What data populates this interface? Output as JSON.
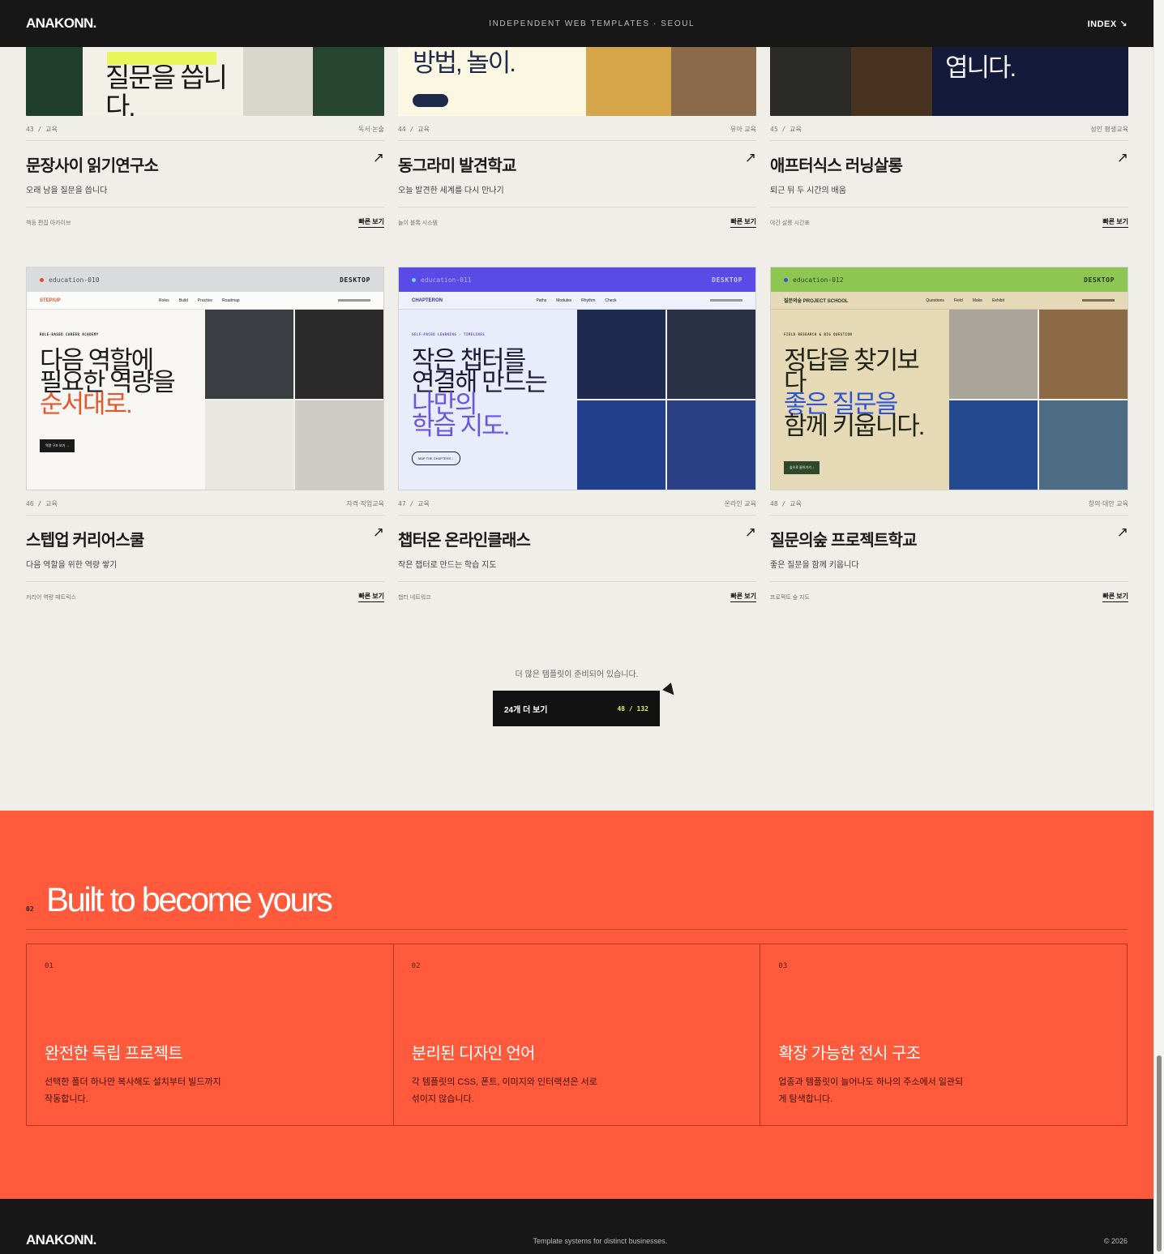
{
  "header": {
    "logo": "ANAKONN.",
    "tagline": "INDEPENDENT WEB TEMPLATES · SEOUL",
    "index": "INDEX ↘"
  },
  "row1": [
    {
      "num": "43 / 교육",
      "category": "독서·논술",
      "title": "문장사이 읽기연구소",
      "subtitle": "오래 남을 질문을 씁니다",
      "tags": "책등 편집 아카이브",
      "quick": "빠른 보기",
      "thumb_text": "질문을 씁니다."
    },
    {
      "num": "44 / 교육",
      "category": "유아 교육",
      "title": "동그라미 발견학교",
      "subtitle": "오늘 발견한 세계를 다시 만나기",
      "tags": "놀이 블록 시스템",
      "quick": "빠른 보기",
      "thumb_text": "방법, 놀이."
    },
    {
      "num": "45 / 교육",
      "category": "성인 평생교육",
      "title": "애프터식스 러닝살롱",
      "subtitle": "퇴근 뒤 두 시간의 배움",
      "tags": "야간 살롱 시간표",
      "quick": "빠른 보기",
      "thumb_text": "엽니다."
    }
  ],
  "row2": [
    {
      "num": "46 / 교육",
      "category": "자격·직업교육",
      "title": "스텝업 커리어스쿨",
      "subtitle": "다음 역할을 위한 역량 쌓기",
      "tags": "커리어 역량 매트릭스",
      "quick": "빠른 보기",
      "preview": {
        "id": "education-010",
        "tag": "DESKTOP",
        "brand": "STEP/UP",
        "nav": [
          "Roles",
          "Build",
          "Practice",
          "Roadmap"
        ],
        "eyebrow": "ROLE-BASED CAREER ACADEMY",
        "line1": "다음 역할에",
        "line2": "필요한 역량을",
        "line3": "순서대로.",
        "cta": "역량 구조 보기 →",
        "dot": "#e4482a",
        "chrome_bg": "#d9dbdc",
        "accent": "#e4572a"
      }
    },
    {
      "num": "47 / 교육",
      "category": "온라인 교육",
      "title": "챕터온 온라인클래스",
      "subtitle": "작은 챕터로 만드는 학습 지도",
      "tags": "챕터 네트워크",
      "quick": "빠른 보기",
      "preview": {
        "id": "education-011",
        "tag": "DESKTOP",
        "brand": "CHAPTERON",
        "nav": [
          "Paths",
          "Modules",
          "Rhythm",
          "Check"
        ],
        "eyebrow": "SELF-PACED LEARNING · TIMELINES",
        "line1": "작은 챕터를",
        "line2": "연결해 만드는",
        "line3": "나만의",
        "line4": "학습 지도.",
        "cta": "MAP THE CHAPTERS ↓",
        "dot": "#7ad3ff",
        "chrome_bg": "#5a4be6",
        "accent": "#5b48d8"
      }
    },
    {
      "num": "48 / 교육",
      "category": "창의·대안 교육",
      "title": "질문의숲 프로젝트학교",
      "subtitle": "좋은 질문을 함께 키웁니다",
      "tags": "프로젝트 숲 지도",
      "quick": "빠른 보기",
      "preview": {
        "id": "education-012",
        "tag": "DESKTOP",
        "brand": "질문의숲 PROJECT SCHOOL",
        "nav": [
          "Questions",
          "Field",
          "Make",
          "Exhibit"
        ],
        "eyebrow": "FIELD RESEARCH & BIG QUESTION",
        "line1": "정답을 찾기보다",
        "line2": "좋은 질문을",
        "line3": "함께 키웁니다.",
        "cta": "숲으로 들어가기 ↓",
        "dot": "#2f55d4",
        "chrome_bg": "#8dc653",
        "accent": "#2f55d4"
      }
    }
  ],
  "more": {
    "text": "더 많은 템플릿이 준비되어 있습니다.",
    "button": "24개 더 보기",
    "count": "48 / 132"
  },
  "section": {
    "num": "02",
    "title": "Built to become yours",
    "features": [
      {
        "num": "01",
        "title": "완전한 독립 프로젝트",
        "desc": "선택한 폴더 하나만 복사해도 설치부터 빌드까지 작동합니다."
      },
      {
        "num": "02",
        "title": "분리된 디자인 언어",
        "desc": "각 템플릿의 CSS, 폰트, 이미지와 인터랙션은 서로 섞이지 않습니다."
      },
      {
        "num": "03",
        "title": "확장 가능한 전시 구조",
        "desc": "업종과 템플릿이 늘어나도 하나의 주소에서 일관되게 탐색합니다."
      }
    ]
  },
  "footer": {
    "logo": "ANAKONN.",
    "tagline": "Template systems for distinct businesses.",
    "copy": "© 2026"
  },
  "colors": {
    "orange": "#ff5a3c",
    "dark": "#171717",
    "page_bg": "#efeee9",
    "counter": "#e5f05a"
  }
}
